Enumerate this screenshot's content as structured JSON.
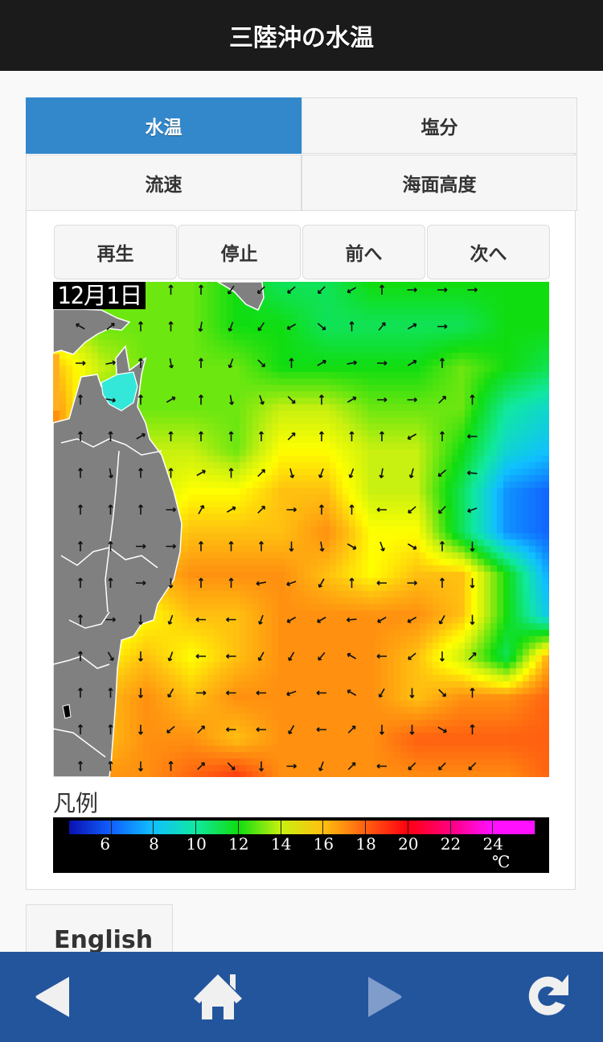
{
  "header": {
    "title": "三陸沖の水温"
  },
  "tabs": [
    {
      "label": "水温",
      "active": true
    },
    {
      "label": "塩分",
      "active": false
    },
    {
      "label": "流速",
      "active": false
    },
    {
      "label": "海面高度",
      "active": false
    }
  ],
  "controls": {
    "play": "再生",
    "stop": "停止",
    "prev": "前へ",
    "next": "次へ"
  },
  "map": {
    "date_label": "12月1日",
    "colors": {
      "land": "#808080",
      "border": "#ffffff"
    },
    "temperature_grid_celsius": [
      [
        13,
        13,
        13,
        13,
        12,
        11,
        11,
        12,
        12,
        12,
        12,
        12
      ],
      [
        14,
        13,
        13,
        13,
        12,
        12,
        11,
        11,
        11,
        11,
        12,
        12
      ],
      [
        16,
        14,
        13,
        13,
        13,
        12,
        12,
        12,
        12,
        13,
        12,
        11
      ],
      [
        17,
        13,
        13,
        13,
        13,
        14,
        14,
        13,
        13,
        13,
        10,
        9
      ],
      [
        17,
        13,
        14,
        14,
        13,
        15,
        15,
        14,
        14,
        12,
        9,
        8
      ],
      [
        17,
        13,
        14,
        15,
        15,
        16,
        16,
        14,
        14,
        11,
        7,
        6
      ],
      [
        14,
        13,
        15,
        16,
        16,
        16,
        17,
        15,
        15,
        11,
        7,
        6
      ],
      [
        13,
        13,
        16,
        17,
        17,
        17,
        16,
        15,
        16,
        16,
        12,
        7
      ],
      [
        13,
        14,
        15,
        16,
        16,
        17,
        17,
        17,
        17,
        16,
        12,
        8
      ],
      [
        13,
        15,
        16,
        15,
        16,
        17,
        17,
        17,
        16,
        14,
        11,
        17
      ],
      [
        13,
        16,
        17,
        16,
        17,
        17,
        17,
        17,
        16,
        17,
        17,
        18
      ],
      [
        13,
        16,
        17,
        17,
        16,
        17,
        17,
        17,
        18,
        18,
        18,
        18
      ],
      [
        13,
        17,
        17,
        18,
        19,
        17,
        17,
        17,
        17,
        17,
        17,
        18
      ]
    ],
    "current_direction_degrees_grid": [
      [
        0,
        120,
        130,
        0,
        0,
        215,
        225,
        230,
        225,
        240,
        0,
        90,
        90,
        90
      ],
      [
        300,
        50,
        0,
        0,
        190,
        200,
        215,
        240,
        130,
        0,
        40,
        60,
        90
      ],
      [
        90,
        80,
        0,
        170,
        0,
        200,
        135,
        0,
        60,
        80,
        90,
        60,
        0
      ],
      [
        0,
        100,
        0,
        60,
        0,
        170,
        160,
        135,
        0,
        60,
        90,
        90,
        45,
        0
      ],
      [
        0,
        0,
        60,
        0,
        0,
        0,
        0,
        45,
        0,
        0,
        0,
        240,
        0,
        270
      ],
      [
        0,
        170,
        0,
        0,
        60,
        0,
        45,
        165,
        200,
        200,
        190,
        195,
        230,
        275
      ],
      [
        0,
        0,
        0,
        90,
        30,
        60,
        45,
        90,
        0,
        0,
        270,
        230,
        225,
        250
      ],
      [
        0,
        0,
        90,
        90,
        0,
        0,
        0,
        180,
        170,
        120,
        160,
        120,
        0,
        180
      ],
      [
        0,
        0,
        90,
        180,
        0,
        0,
        260,
        250,
        210,
        0,
        270,
        90,
        0,
        180
      ],
      [
        0,
        90,
        180,
        200,
        270,
        270,
        200,
        240,
        240,
        265,
        240,
        240,
        210,
        180
      ],
      [
        0,
        150,
        180,
        200,
        270,
        270,
        210,
        210,
        220,
        300,
        270,
        230,
        180,
        45
      ],
      [
        0,
        0,
        180,
        210,
        90,
        270,
        270,
        250,
        270,
        300,
        210,
        180,
        135,
        0
      ],
      [
        0,
        0,
        180,
        230,
        45,
        270,
        270,
        210,
        270,
        45,
        180,
        180,
        120,
        0
      ],
      [
        0,
        0,
        180,
        0,
        45,
        135,
        180,
        90,
        200,
        45,
        270,
        225,
        225,
        225
      ]
    ]
  },
  "legend": {
    "title": "凡例",
    "ticks": [
      "6",
      "8",
      "10",
      "12",
      "14",
      "16",
      "18",
      "20",
      "22",
      "24"
    ],
    "unit": "℃",
    "colors": [
      "#0a10b0",
      "#1060ff",
      "#10c0ff",
      "#10e8a0",
      "#10dd10",
      "#c8f010",
      "#ffc010",
      "#ff6010",
      "#ff0010",
      "#ff0080",
      "#ff10ff"
    ]
  },
  "language_button": {
    "label": "English"
  },
  "footer": {
    "buttons": [
      {
        "icon": "back-arrow-icon"
      },
      {
        "icon": "home-icon"
      },
      {
        "icon": "forward-arrow-icon"
      },
      {
        "icon": "reload-icon"
      }
    ]
  }
}
